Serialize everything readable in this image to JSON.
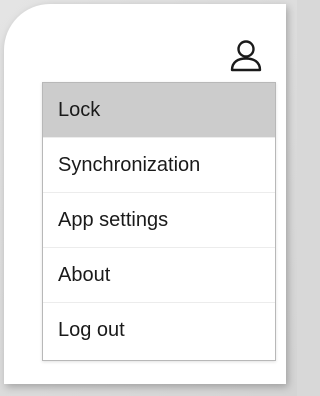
{
  "header": {
    "account_icon": "person-outline-icon"
  },
  "menu": {
    "items": [
      {
        "label": "Lock",
        "selected": true
      },
      {
        "label": "Synchronization",
        "selected": false
      },
      {
        "label": "App settings",
        "selected": false
      },
      {
        "label": "About",
        "selected": false
      },
      {
        "label": "Log out",
        "selected": false
      }
    ]
  },
  "colors": {
    "selected_background": "#cccccc",
    "menu_border": "#b8b8b8",
    "text": "#1a1a1a"
  }
}
